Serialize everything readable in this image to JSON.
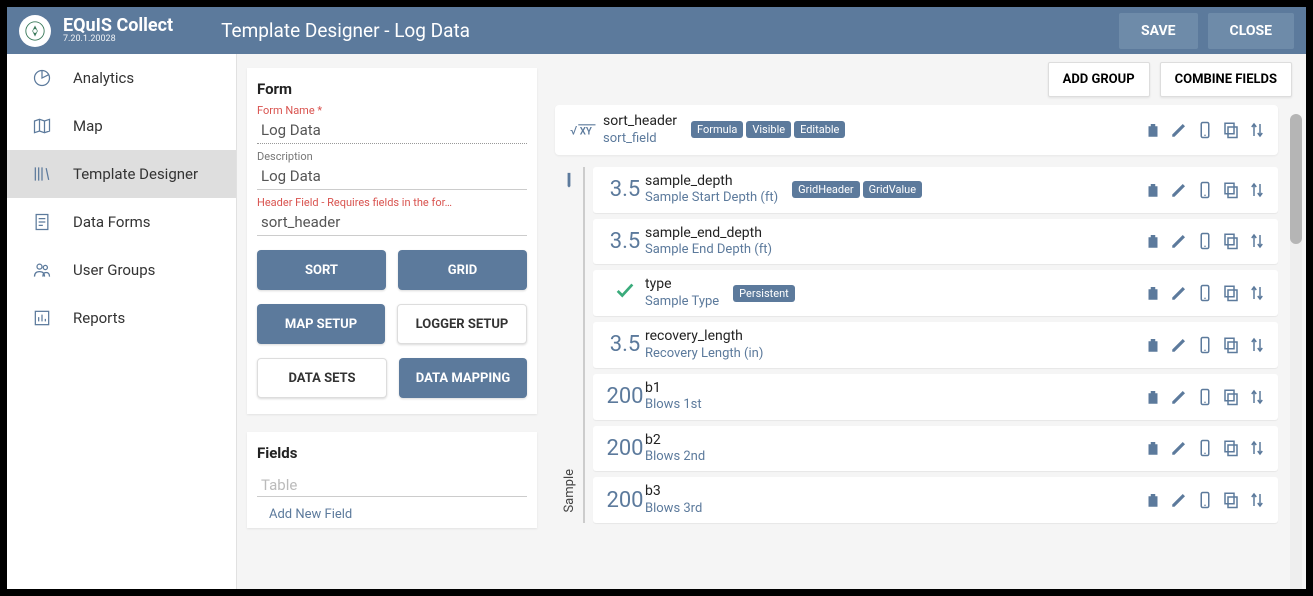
{
  "brand": {
    "name": "EQuIS Collect",
    "version": "7.20.1.20028"
  },
  "page_title": "Template Designer - Log Data",
  "header": {
    "save": "SAVE",
    "close": "CLOSE"
  },
  "nav": [
    {
      "label": "Analytics",
      "icon": "pie"
    },
    {
      "label": "Map",
      "icon": "map"
    },
    {
      "label": "Template Designer",
      "icon": "books",
      "active": true
    },
    {
      "label": "Data Forms",
      "icon": "form"
    },
    {
      "label": "User Groups",
      "icon": "users"
    },
    {
      "label": "Reports",
      "icon": "bars"
    }
  ],
  "form": {
    "title": "Form",
    "name_label": "Form Name *",
    "name_value": "Log Data",
    "desc_label": "Description",
    "desc_value": "Log Data",
    "header_label": "Header Field - Requires fields in the for…",
    "header_value": "sort_header",
    "buttons": {
      "sort": "SORT",
      "grid": "GRID",
      "map": "MAP SETUP",
      "logger": "LOGGER SETUP",
      "datasets": "DATA SETS",
      "mapping": "DATA MAPPING"
    }
  },
  "fields_panel": {
    "title": "Fields",
    "table_placeholder": "Table",
    "add_new": "Add New Field"
  },
  "main_buttons": {
    "add_group": "ADD GROUP",
    "combine": "COMBINE FIELDS"
  },
  "sort_header": {
    "name": "sort_header",
    "desc": "sort_field",
    "badges": [
      "Formula",
      "Visible",
      "Editable"
    ]
  },
  "group_label": "Sample",
  "group_fields": [
    {
      "type": "3.5",
      "name": "sample_depth",
      "desc": "Sample Start Depth (ft)",
      "badges": [
        "GridHeader",
        "GridValue"
      ]
    },
    {
      "type": "3.5",
      "name": "sample_end_depth",
      "desc": "Sample End Depth (ft)",
      "badges": []
    },
    {
      "type": "check",
      "name": "type",
      "desc": "Sample Type",
      "badges": [
        "Persistent"
      ]
    },
    {
      "type": "3.5",
      "name": "recovery_length",
      "desc": "Recovery Length (in)",
      "badges": []
    },
    {
      "type": "200",
      "name": "b1",
      "desc": "Blows 1st",
      "badges": []
    },
    {
      "type": "200",
      "name": "b2",
      "desc": "Blows 2nd",
      "badges": []
    },
    {
      "type": "200",
      "name": "b3",
      "desc": "Blows 3rd",
      "badges": []
    }
  ]
}
